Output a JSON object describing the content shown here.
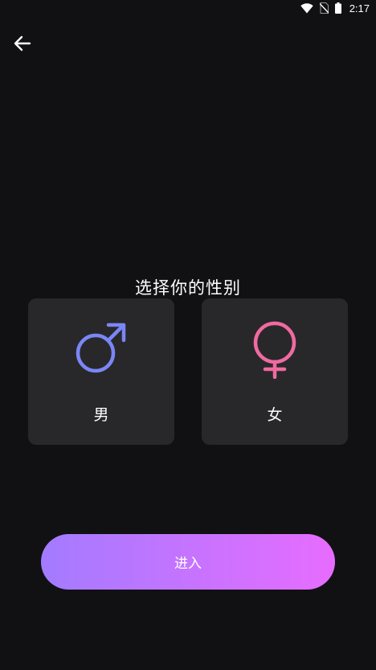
{
  "status_bar": {
    "time": "2:17",
    "icons": [
      "wifi-icon",
      "no-sim-icon",
      "battery-icon"
    ]
  },
  "header": {
    "back_icon": "arrow-left-icon"
  },
  "gender_select": {
    "title": "选择你的性别",
    "options": [
      {
        "label": "男",
        "icon": "male-symbol-icon",
        "color": "#7b86f5"
      },
      {
        "label": "女",
        "icon": "female-symbol-icon",
        "color": "#f06aa0"
      }
    ]
  },
  "actions": {
    "enter_label": "进入",
    "gradient_start": "#a37bff",
    "gradient_end": "#e76cff"
  },
  "colors": {
    "background": "#111113",
    "card": "#28282b"
  }
}
